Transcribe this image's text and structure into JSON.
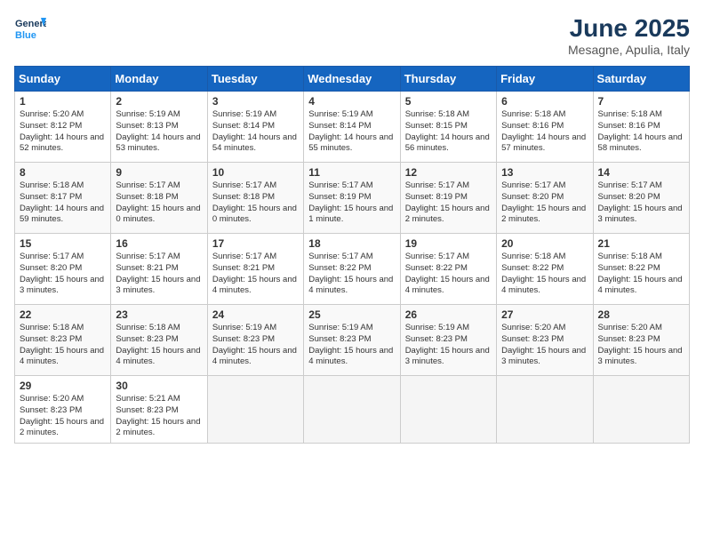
{
  "logo": {
    "line1": "General",
    "line2": "Blue"
  },
  "title": "June 2025",
  "location": "Mesagne, Apulia, Italy",
  "headers": [
    "Sunday",
    "Monday",
    "Tuesday",
    "Wednesday",
    "Thursday",
    "Friday",
    "Saturday"
  ],
  "weeks": [
    [
      {
        "day": "1",
        "sunrise": "5:20 AM",
        "sunset": "8:12 PM",
        "daylight": "14 hours and 52 minutes."
      },
      {
        "day": "2",
        "sunrise": "5:19 AM",
        "sunset": "8:13 PM",
        "daylight": "14 hours and 53 minutes."
      },
      {
        "day": "3",
        "sunrise": "5:19 AM",
        "sunset": "8:14 PM",
        "daylight": "14 hours and 54 minutes."
      },
      {
        "day": "4",
        "sunrise": "5:19 AM",
        "sunset": "8:14 PM",
        "daylight": "14 hours and 55 minutes."
      },
      {
        "day": "5",
        "sunrise": "5:18 AM",
        "sunset": "8:15 PM",
        "daylight": "14 hours and 56 minutes."
      },
      {
        "day": "6",
        "sunrise": "5:18 AM",
        "sunset": "8:16 PM",
        "daylight": "14 hours and 57 minutes."
      },
      {
        "day": "7",
        "sunrise": "5:18 AM",
        "sunset": "8:16 PM",
        "daylight": "14 hours and 58 minutes."
      }
    ],
    [
      {
        "day": "8",
        "sunrise": "5:18 AM",
        "sunset": "8:17 PM",
        "daylight": "14 hours and 59 minutes."
      },
      {
        "day": "9",
        "sunrise": "5:17 AM",
        "sunset": "8:18 PM",
        "daylight": "15 hours and 0 minutes."
      },
      {
        "day": "10",
        "sunrise": "5:17 AM",
        "sunset": "8:18 PM",
        "daylight": "15 hours and 0 minutes."
      },
      {
        "day": "11",
        "sunrise": "5:17 AM",
        "sunset": "8:19 PM",
        "daylight": "15 hours and 1 minute."
      },
      {
        "day": "12",
        "sunrise": "5:17 AM",
        "sunset": "8:19 PM",
        "daylight": "15 hours and 2 minutes."
      },
      {
        "day": "13",
        "sunrise": "5:17 AM",
        "sunset": "8:20 PM",
        "daylight": "15 hours and 2 minutes."
      },
      {
        "day": "14",
        "sunrise": "5:17 AM",
        "sunset": "8:20 PM",
        "daylight": "15 hours and 3 minutes."
      }
    ],
    [
      {
        "day": "15",
        "sunrise": "5:17 AM",
        "sunset": "8:20 PM",
        "daylight": "15 hours and 3 minutes."
      },
      {
        "day": "16",
        "sunrise": "5:17 AM",
        "sunset": "8:21 PM",
        "daylight": "15 hours and 3 minutes."
      },
      {
        "day": "17",
        "sunrise": "5:17 AM",
        "sunset": "8:21 PM",
        "daylight": "15 hours and 4 minutes."
      },
      {
        "day": "18",
        "sunrise": "5:17 AM",
        "sunset": "8:22 PM",
        "daylight": "15 hours and 4 minutes."
      },
      {
        "day": "19",
        "sunrise": "5:17 AM",
        "sunset": "8:22 PM",
        "daylight": "15 hours and 4 minutes."
      },
      {
        "day": "20",
        "sunrise": "5:18 AM",
        "sunset": "8:22 PM",
        "daylight": "15 hours and 4 minutes."
      },
      {
        "day": "21",
        "sunrise": "5:18 AM",
        "sunset": "8:22 PM",
        "daylight": "15 hours and 4 minutes."
      }
    ],
    [
      {
        "day": "22",
        "sunrise": "5:18 AM",
        "sunset": "8:23 PM",
        "daylight": "15 hours and 4 minutes."
      },
      {
        "day": "23",
        "sunrise": "5:18 AM",
        "sunset": "8:23 PM",
        "daylight": "15 hours and 4 minutes."
      },
      {
        "day": "24",
        "sunrise": "5:19 AM",
        "sunset": "8:23 PM",
        "daylight": "15 hours and 4 minutes."
      },
      {
        "day": "25",
        "sunrise": "5:19 AM",
        "sunset": "8:23 PM",
        "daylight": "15 hours and 4 minutes."
      },
      {
        "day": "26",
        "sunrise": "5:19 AM",
        "sunset": "8:23 PM",
        "daylight": "15 hours and 3 minutes."
      },
      {
        "day": "27",
        "sunrise": "5:20 AM",
        "sunset": "8:23 PM",
        "daylight": "15 hours and 3 minutes."
      },
      {
        "day": "28",
        "sunrise": "5:20 AM",
        "sunset": "8:23 PM",
        "daylight": "15 hours and 3 minutes."
      }
    ],
    [
      {
        "day": "29",
        "sunrise": "5:20 AM",
        "sunset": "8:23 PM",
        "daylight": "15 hours and 2 minutes."
      },
      {
        "day": "30",
        "sunrise": "5:21 AM",
        "sunset": "8:23 PM",
        "daylight": "15 hours and 2 minutes."
      },
      null,
      null,
      null,
      null,
      null
    ]
  ]
}
